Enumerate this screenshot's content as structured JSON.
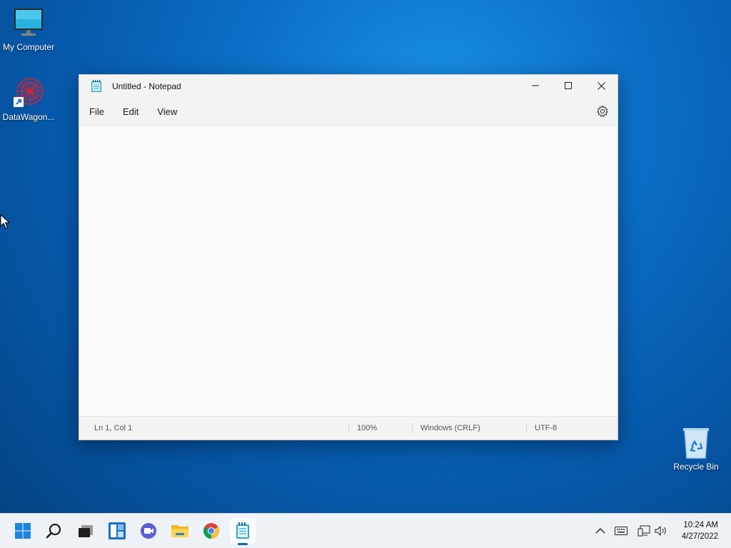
{
  "desktop": {
    "icons": [
      {
        "label": "My Computer"
      },
      {
        "label": "DataWagon..."
      },
      {
        "label": "Recycle Bin"
      }
    ]
  },
  "window": {
    "title": "Untitled - Notepad",
    "menu": [
      "File",
      "Edit",
      "View"
    ],
    "editor_text": "",
    "status": {
      "position": "Ln 1, Col 1",
      "zoom": "100%",
      "line_ending": "Windows (CRLF)",
      "encoding": "UTF-8"
    }
  },
  "taskbar": {
    "apps": [
      "start",
      "search",
      "task-view",
      "widgets",
      "chat",
      "file-explorer",
      "chrome",
      "notepad"
    ],
    "active_app": "notepad",
    "clock": {
      "time": "10:24 AM",
      "date": "4/27/2022"
    }
  },
  "colors": {
    "accent": "#0067c0",
    "desktop": "#0a6cc4"
  }
}
